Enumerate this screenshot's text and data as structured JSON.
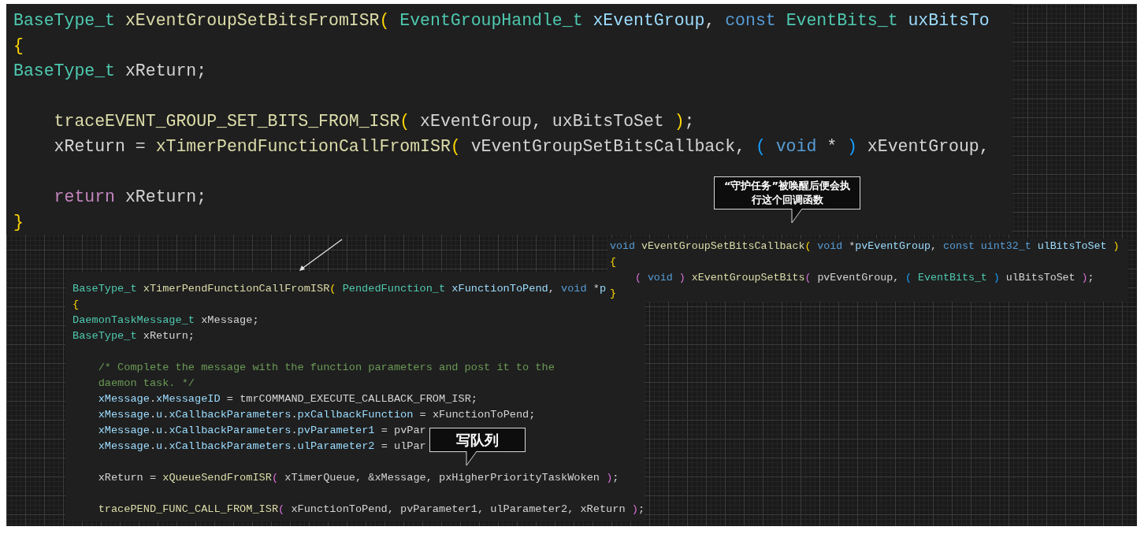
{
  "panels": [
    {
      "lines": [
        {
          "kind": "code",
          "tokens": [
            {
              "kind": "type",
              "text": "BaseType_t "
            },
            {
              "kind": "func",
              "text": "xEventGroupSetBitsFromISR"
            },
            {
              "kind": "b1",
              "text": "( "
            },
            {
              "kind": "type",
              "text": "EventGroupHandle_t "
            },
            {
              "kind": "param",
              "text": "xEventGroup"
            },
            {
              "kind": "plain",
              "text": ", "
            },
            {
              "kind": "keyword",
              "text": "const "
            },
            {
              "kind": "type",
              "text": "EventBits_t "
            },
            {
              "kind": "param",
              "text": "uxBitsTo"
            }
          ]
        },
        {
          "kind": "code",
          "tokens": [
            {
              "kind": "b1",
              "text": "{"
            }
          ]
        },
        {
          "kind": "code",
          "tokens": [
            {
              "kind": "type",
              "text": "BaseType_t "
            },
            {
              "kind": "plain",
              "text": "xReturn;"
            }
          ]
        },
        {
          "kind": "blank"
        },
        {
          "kind": "code",
          "tokens": [
            {
              "kind": "func",
              "text": "    traceEVENT_GROUP_SET_BITS_FROM_ISR"
            },
            {
              "kind": "b1",
              "text": "( "
            },
            {
              "kind": "plain",
              "text": "xEventGroup, uxBitsToSet "
            },
            {
              "kind": "b1",
              "text": ")"
            },
            {
              "kind": "plain",
              "text": ";"
            }
          ]
        },
        {
          "kind": "code",
          "tokens": [
            {
              "kind": "plain",
              "text": "    xReturn = "
            },
            {
              "kind": "func",
              "text": "xTimerPendFunctionCallFromISR"
            },
            {
              "kind": "b1",
              "text": "( "
            },
            {
              "kind": "plain",
              "text": "vEventGroupSetBitsCallback, "
            },
            {
              "kind": "b3",
              "text": "( "
            },
            {
              "kind": "keyword",
              "text": "void"
            },
            {
              "kind": "plain",
              "text": " * "
            },
            {
              "kind": "b3",
              "text": ") "
            },
            {
              "kind": "plain",
              "text": "xEventGroup,"
            }
          ]
        },
        {
          "kind": "blank"
        },
        {
          "kind": "code",
          "tokens": [
            {
              "kind": "control",
              "text": "    return "
            },
            {
              "kind": "plain",
              "text": "xReturn;"
            }
          ]
        },
        {
          "kind": "code",
          "tokens": [
            {
              "kind": "b1",
              "text": "}"
            }
          ]
        }
      ]
    },
    {
      "lines": [
        {
          "kind": "code",
          "tokens": [
            {
              "kind": "type",
              "text": "BaseType_t "
            },
            {
              "kind": "func",
              "text": "xTimerPendFunctionCallFromISR"
            },
            {
              "kind": "b1",
              "text": "( "
            },
            {
              "kind": "type",
              "text": "PendedFunction_t "
            },
            {
              "kind": "param",
              "text": "xFunctionToPend"
            },
            {
              "kind": "plain",
              "text": ", "
            },
            {
              "kind": "keyword",
              "text": "void "
            },
            {
              "kind": "plain",
              "text": "*"
            },
            {
              "kind": "param",
              "text": "p"
            }
          ]
        },
        {
          "kind": "code",
          "tokens": [
            {
              "kind": "b1",
              "text": "{"
            }
          ]
        },
        {
          "kind": "code",
          "tokens": [
            {
              "kind": "type",
              "text": "DaemonTaskMessage_t "
            },
            {
              "kind": "plain",
              "text": "xMessage;"
            }
          ]
        },
        {
          "kind": "code",
          "tokens": [
            {
              "kind": "type",
              "text": "BaseType_t "
            },
            {
              "kind": "plain",
              "text": "xReturn;"
            }
          ]
        },
        {
          "kind": "blank"
        },
        {
          "kind": "code",
          "tokens": [
            {
              "kind": "comment",
              "text": "    /* Complete the message with the function parameters and post it to the"
            }
          ]
        },
        {
          "kind": "code",
          "tokens": [
            {
              "kind": "comment",
              "text": "    daemon task. */"
            }
          ]
        },
        {
          "kind": "code",
          "tokens": [
            {
              "kind": "param",
              "text": "    xMessage"
            },
            {
              "kind": "plain",
              "text": "."
            },
            {
              "kind": "param",
              "text": "xMessageID"
            },
            {
              "kind": "plain",
              "text": " = tmrCOMMAND_EXECUTE_CALLBACK_FROM_ISR;"
            }
          ]
        },
        {
          "kind": "code",
          "tokens": [
            {
              "kind": "param",
              "text": "    xMessage"
            },
            {
              "kind": "plain",
              "text": "."
            },
            {
              "kind": "param",
              "text": "u"
            },
            {
              "kind": "plain",
              "text": "."
            },
            {
              "kind": "param",
              "text": "xCallbackParameters"
            },
            {
              "kind": "plain",
              "text": "."
            },
            {
              "kind": "param",
              "text": "pxCallbackFunction"
            },
            {
              "kind": "plain",
              "text": " = xFunctionToPend;"
            }
          ]
        },
        {
          "kind": "code",
          "tokens": [
            {
              "kind": "param",
              "text": "    xMessage"
            },
            {
              "kind": "plain",
              "text": "."
            },
            {
              "kind": "param",
              "text": "u"
            },
            {
              "kind": "plain",
              "text": "."
            },
            {
              "kind": "param",
              "text": "xCallbackParameters"
            },
            {
              "kind": "plain",
              "text": "."
            },
            {
              "kind": "param",
              "text": "pvParameter1"
            },
            {
              "kind": "plain",
              "text": " = pvPar"
            }
          ]
        },
        {
          "kind": "code",
          "tokens": [
            {
              "kind": "param",
              "text": "    xMessage"
            },
            {
              "kind": "plain",
              "text": "."
            },
            {
              "kind": "param",
              "text": "u"
            },
            {
              "kind": "plain",
              "text": "."
            },
            {
              "kind": "param",
              "text": "xCallbackParameters"
            },
            {
              "kind": "plain",
              "text": "."
            },
            {
              "kind": "param",
              "text": "ulParameter2"
            },
            {
              "kind": "plain",
              "text": " = ulPar"
            }
          ]
        },
        {
          "kind": "blank"
        },
        {
          "kind": "code",
          "tokens": [
            {
              "kind": "plain",
              "text": "    xReturn = "
            },
            {
              "kind": "func",
              "text": "xQueueSendFromISR"
            },
            {
              "kind": "b2",
              "text": "( "
            },
            {
              "kind": "plain",
              "text": "xTimerQueue, &xMessage, pxHigherPriorityTaskWoken "
            },
            {
              "kind": "b2",
              "text": ")"
            },
            {
              "kind": "plain",
              "text": ";"
            }
          ]
        },
        {
          "kind": "blank"
        },
        {
          "kind": "code",
          "tokens": [
            {
              "kind": "func",
              "text": "    tracePEND_FUNC_CALL_FROM_ISR"
            },
            {
              "kind": "b2",
              "text": "( "
            },
            {
              "kind": "plain",
              "text": "xFunctionToPend, pvParameter1, ulParameter2, xReturn "
            },
            {
              "kind": "b2",
              "text": ")"
            },
            {
              "kind": "plain",
              "text": ";"
            }
          ]
        }
      ]
    },
    {
      "lines": [
        {
          "kind": "code",
          "tokens": [
            {
              "kind": "keyword",
              "text": "void "
            },
            {
              "kind": "func",
              "text": "vEventGroupSetBitsCallback"
            },
            {
              "kind": "b1",
              "text": "( "
            },
            {
              "kind": "keyword",
              "text": "void "
            },
            {
              "kind": "plain",
              "text": "*"
            },
            {
              "kind": "param",
              "text": "pvEventGroup"
            },
            {
              "kind": "plain",
              "text": ", "
            },
            {
              "kind": "keyword",
              "text": "const uint32_t "
            },
            {
              "kind": "param",
              "text": "ulBitsToSet "
            },
            {
              "kind": "b1",
              "text": ")"
            }
          ]
        },
        {
          "kind": "code",
          "tokens": [
            {
              "kind": "b1",
              "text": "{"
            }
          ]
        },
        {
          "kind": "code",
          "tokens": [
            {
              "kind": "b2",
              "text": "    ( "
            },
            {
              "kind": "keyword",
              "text": "void "
            },
            {
              "kind": "b2",
              "text": ") "
            },
            {
              "kind": "func",
              "text": "xEventGroupSetBits"
            },
            {
              "kind": "b2",
              "text": "( "
            },
            {
              "kind": "plain",
              "text": "pvEventGroup, "
            },
            {
              "kind": "b3",
              "text": "( "
            },
            {
              "kind": "type",
              "text": "EventBits_t "
            },
            {
              "kind": "b3",
              "text": ") "
            },
            {
              "kind": "plain",
              "text": "ulBitsToSet "
            },
            {
              "kind": "b2",
              "text": ")"
            },
            {
              "kind": "plain",
              "text": ";"
            }
          ]
        },
        {
          "kind": "code",
          "tokens": [
            {
              "kind": "b1",
              "text": "}"
            }
          ]
        }
      ]
    }
  ],
  "callouts": [
    {
      "lines": [
        "“守护任务”被唤醒后便会执",
        "行这个回调函数"
      ]
    },
    {
      "lines": [
        "写队列"
      ]
    }
  ]
}
